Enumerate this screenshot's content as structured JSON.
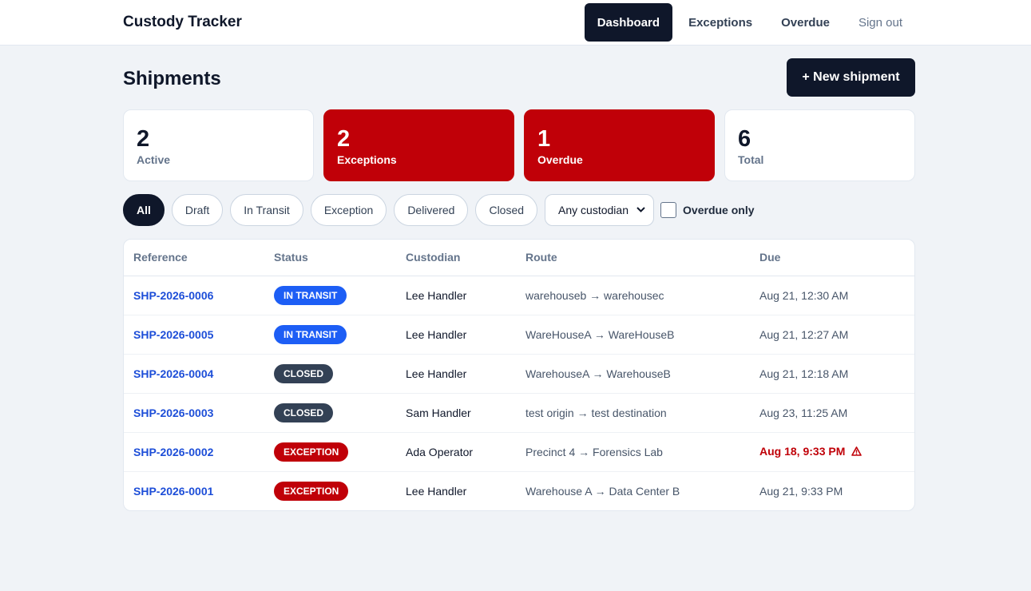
{
  "app": {
    "title": "Custody Tracker"
  },
  "nav": [
    {
      "label": "Dashboard",
      "active": true
    },
    {
      "label": "Exceptions",
      "active": false
    },
    {
      "label": "Overdue",
      "active": false
    },
    {
      "label": "Sign out",
      "active": false
    }
  ],
  "page": {
    "title": "Shipments",
    "new_button": "+ New shipment"
  },
  "stats": [
    {
      "value": "2",
      "label": "Active",
      "highlight": false
    },
    {
      "value": "2",
      "label": "Exceptions",
      "highlight": true
    },
    {
      "value": "1",
      "label": "Overdue",
      "highlight": true
    },
    {
      "value": "6",
      "label": "Total",
      "highlight": false
    }
  ],
  "filters": {
    "chips": [
      "All",
      "Draft",
      "In Transit",
      "Exception",
      "Delivered",
      "Closed"
    ],
    "active_chip": "All",
    "custodian_select": "Any custodian",
    "overdue_only_label": "Overdue only",
    "overdue_only_checked": false
  },
  "table": {
    "headers": [
      "Reference",
      "Status",
      "Custodian",
      "Route",
      "Due"
    ],
    "rows": [
      {
        "reference": "SHP-2026-0006",
        "status": "IN TRANSIT",
        "custodian": "Lee Handler",
        "route": "warehouseb → warehousec",
        "due": "Aug 21, 12:30 AM",
        "overdue": false
      },
      {
        "reference": "SHP-2026-0005",
        "status": "IN TRANSIT",
        "custodian": "Lee Handler",
        "route": "WareHouseA → WareHouseB",
        "due": "Aug 21, 12:27 AM",
        "overdue": false
      },
      {
        "reference": "SHP-2026-0004",
        "status": "CLOSED",
        "custodian": "Lee Handler",
        "route": "WarehouseA → WarehouseB",
        "due": "Aug 21, 12:18 AM",
        "overdue": false
      },
      {
        "reference": "SHP-2026-0003",
        "status": "CLOSED",
        "custodian": "Sam Handler",
        "route": "test origin → test destination",
        "due": "Aug 23, 11:25 AM",
        "overdue": false
      },
      {
        "reference": "SHP-2026-0002",
        "status": "EXCEPTION",
        "custodian": "Ada Operator",
        "route": "Precinct 4 → Forensics Lab",
        "due": "Aug 18, 9:33 PM",
        "overdue": true
      },
      {
        "reference": "SHP-2026-0001",
        "status": "EXCEPTION",
        "custodian": "Lee Handler",
        "route": "Warehouse A → Data Center B",
        "due": "Aug 21, 9:33 PM",
        "overdue": false
      }
    ]
  },
  "colors": {
    "in_transit": "#1d5ef5",
    "closed": "#334155",
    "exception": "#c00008",
    "primary": "#0f172a",
    "link": "#1d4ed8"
  }
}
